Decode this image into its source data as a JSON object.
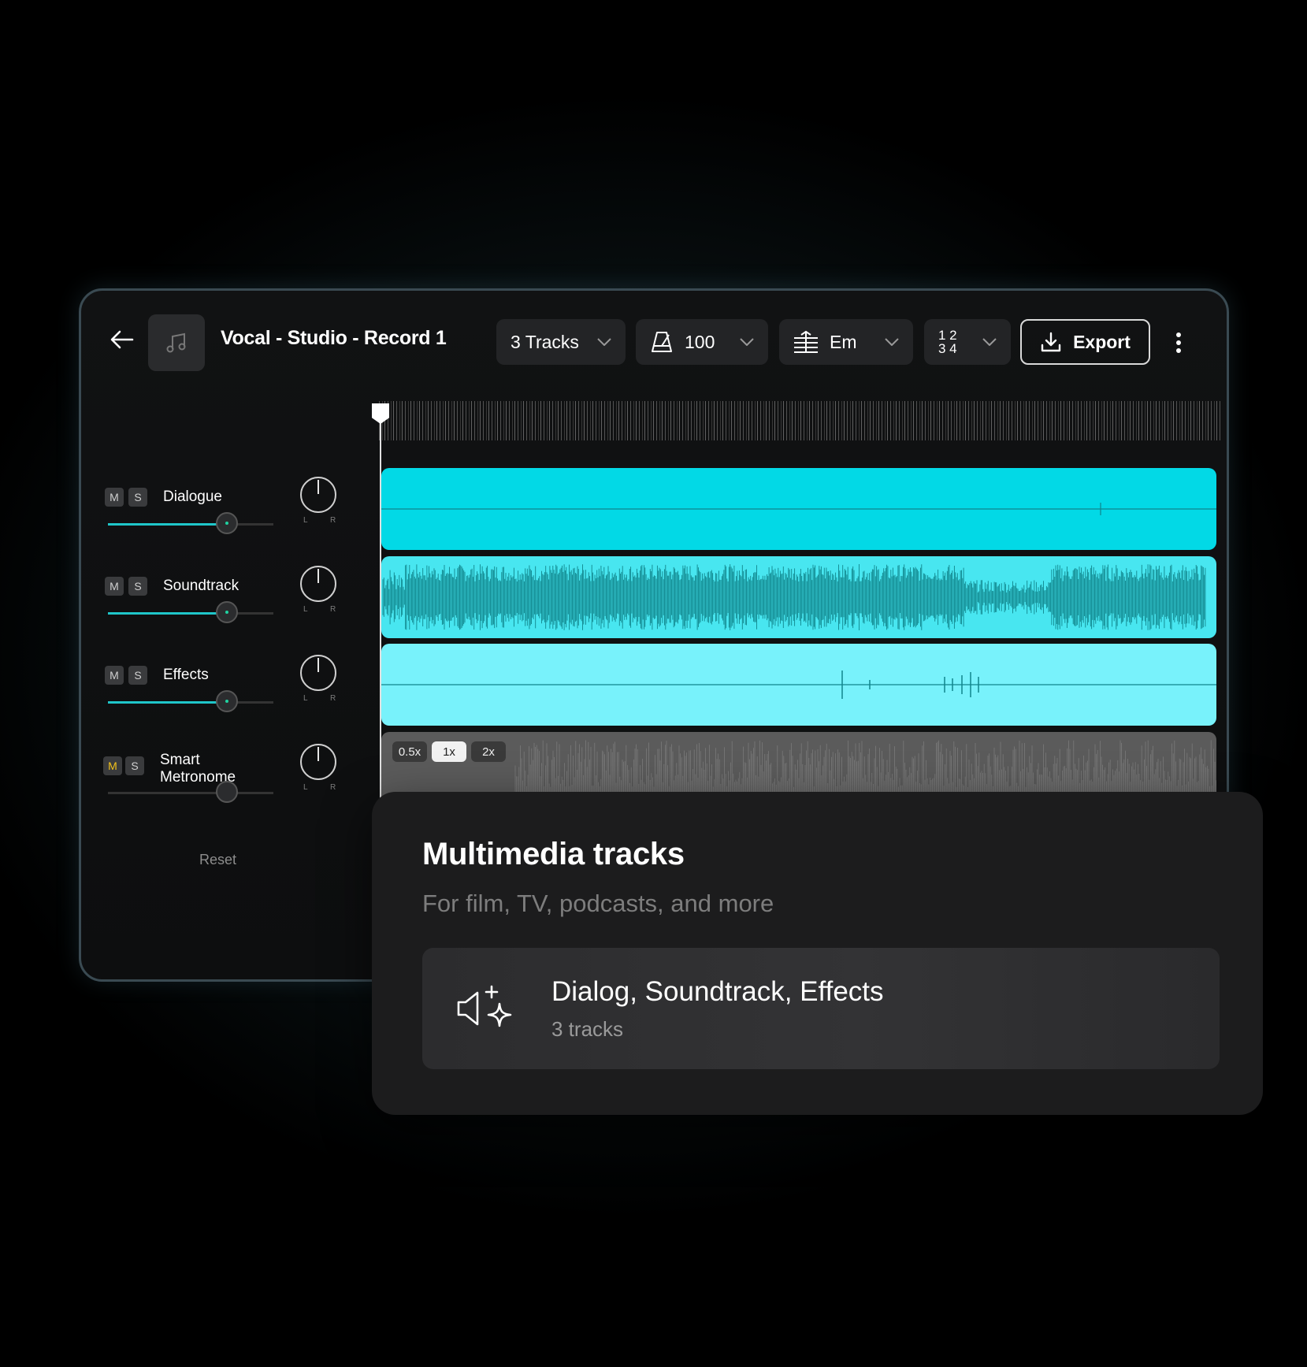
{
  "header": {
    "title": "Vocal - Studio - Record 1",
    "tracks_label": "3 Tracks",
    "tempo": "100",
    "key": "Em",
    "time_signature_top": "1 2",
    "time_signature_bottom": "3 4",
    "export_label": "Export"
  },
  "tracks": [
    {
      "mute": "M",
      "solo": "S",
      "name": "Dialogue",
      "volume": 0.72,
      "pan_left": "L",
      "pan_right": "R"
    },
    {
      "mute": "M",
      "solo": "S",
      "name": "Soundtrack",
      "volume": 0.72,
      "pan_left": "L",
      "pan_right": "R"
    },
    {
      "mute": "M",
      "solo": "S",
      "name": "Effects",
      "volume": 0.72,
      "pan_left": "L",
      "pan_right": "R"
    },
    {
      "mute": "M",
      "solo": "S",
      "name_line1": "Smart",
      "name_line2": "Metronome",
      "volume": 0.72,
      "pan_left": "L",
      "pan_right": "R"
    }
  ],
  "reset_label": "Reset",
  "speed_options": {
    "slow": "0.5x",
    "normal": "1x",
    "fast": "2x",
    "selected": "1x"
  },
  "colors": {
    "dialogue_lane": "#02d9e6",
    "soundtrack_lane": "#48e6f0",
    "effects_lane": "#78f2fb",
    "waveform": "#11858c",
    "accent": "#1fc6c9",
    "metronome_mute": "#f2c21b"
  },
  "card": {
    "title": "Multimedia tracks",
    "subtitle": "For film, TV, podcasts, and more",
    "option_title": "Dialog, Soundtrack, Effects",
    "option_subtitle": "3 tracks",
    "option_icon": "speaker-sparkle-icon"
  }
}
